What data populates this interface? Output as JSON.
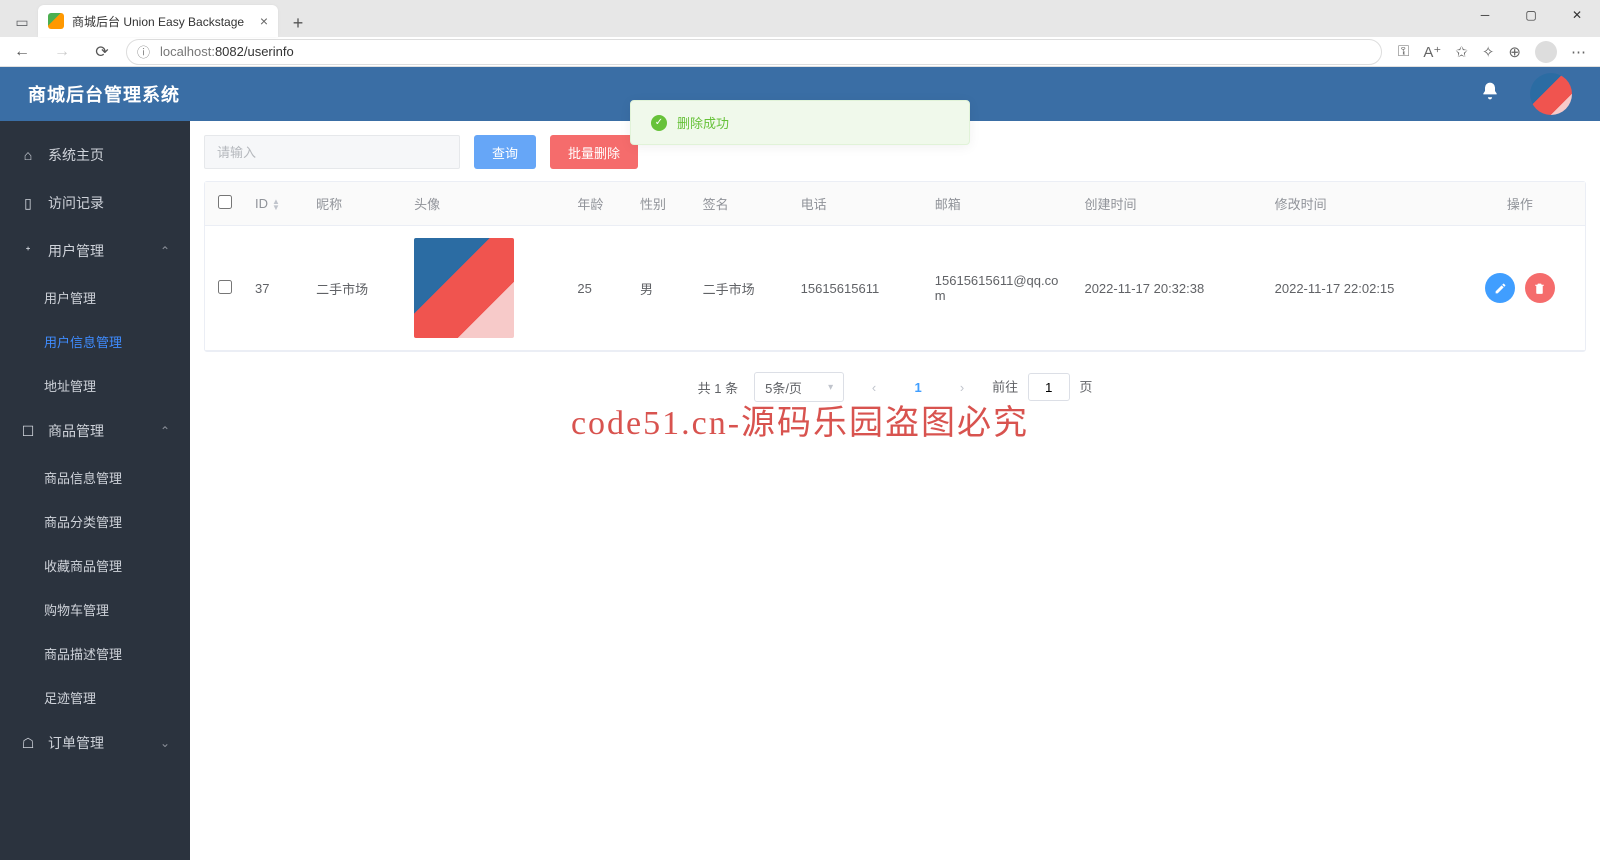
{
  "browser": {
    "tab_title": "商城后台 Union Easy Backstage",
    "url_host": "localhost:",
    "url_port": "8082",
    "url_path": "/userinfo"
  },
  "header": {
    "brand": "商城后台管理系统"
  },
  "sidebar": {
    "home": "系统主页",
    "visits": "访问记录",
    "users": "用户管理",
    "users_sub": {
      "manage": "用户管理",
      "info": "用户信息管理",
      "address": "地址管理"
    },
    "goods": "商品管理",
    "goods_sub": {
      "info": "商品信息管理",
      "cat": "商品分类管理",
      "fav": "收藏商品管理",
      "cart": "购物车管理",
      "desc": "商品描述管理",
      "track": "足迹管理"
    },
    "orders": "订单管理"
  },
  "toolbar": {
    "search_placeholder": "请输入",
    "search_label": "查询",
    "batch_delete_label": "批量删除"
  },
  "toast": {
    "message": "删除成功"
  },
  "table": {
    "headers": {
      "id": "ID",
      "nickname": "昵称",
      "avatar": "头像",
      "age": "年龄",
      "gender": "性别",
      "signature": "签名",
      "phone": "电话",
      "email": "邮箱",
      "created": "创建时间",
      "modified": "修改时间",
      "actions": "操作"
    },
    "rows": [
      {
        "id": "37",
        "nickname": "二手市场",
        "age": "25",
        "gender": "男",
        "signature": "二手市场",
        "phone": "15615615611",
        "email": "15615615611@qq.com",
        "created": "2022-11-17 20:32:38",
        "modified": "2022-11-17 22:02:15"
      }
    ]
  },
  "pagination": {
    "total": "共 1 条",
    "page_size": "5条/页",
    "current": "1",
    "jump_prefix": "前往",
    "jump_value": "1",
    "jump_suffix": "页"
  },
  "watermark": "code51.cn-源码乐园盗图必究"
}
